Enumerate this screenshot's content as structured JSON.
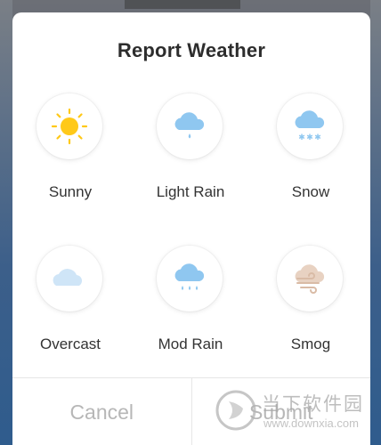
{
  "dialog": {
    "title": "Report Weather",
    "options": [
      {
        "label": "Sunny",
        "icon": "sun-icon"
      },
      {
        "label": "Light Rain",
        "icon": "light-rain-icon"
      },
      {
        "label": "Snow",
        "icon": "snow-icon"
      },
      {
        "label": "Overcast",
        "icon": "overcast-icon"
      },
      {
        "label": "Mod Rain",
        "icon": "moderate-rain-icon"
      },
      {
        "label": "Smog",
        "icon": "smog-icon"
      }
    ],
    "cancel_label": "Cancel",
    "submit_label": "Submit"
  },
  "watermark": {
    "text": "当下软件园",
    "url": "www.downxia.com"
  },
  "colors": {
    "sun": "#FFC919",
    "cloud_blue": "#8FC7F0",
    "cloud_light": "#CFE5F7",
    "smog": "#E8D2C2",
    "button_text": "#B7B7B7",
    "title_text": "#2D2D2D"
  }
}
